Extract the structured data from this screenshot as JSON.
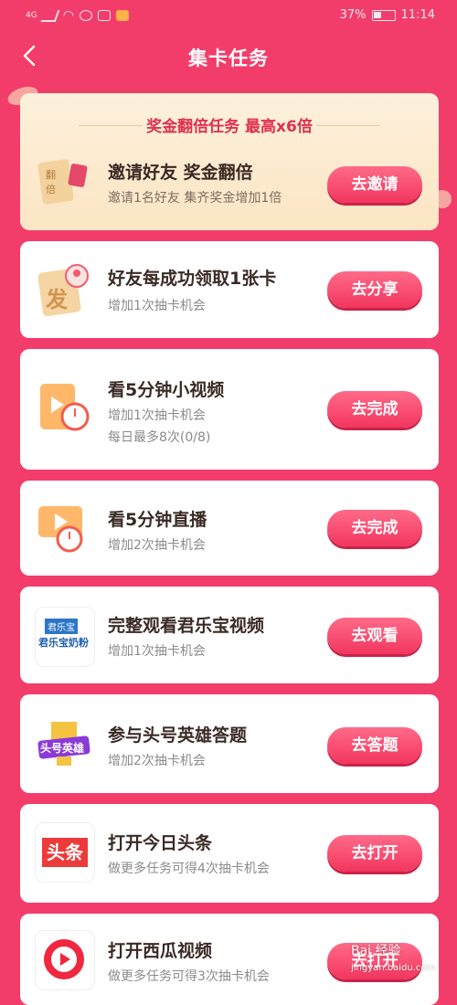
{
  "status": {
    "signal": "4G",
    "battery": "37%",
    "time": "11:14"
  },
  "header": {
    "title": "集卡任务"
  },
  "banner": {
    "headline": "奖金翻倍任务 最高x6倍",
    "task": {
      "title": "邀请好友 奖金翻倍",
      "subtitle": "邀请1名好友 集齐奖金增加1倍",
      "button": "去邀请",
      "icon_text": "翻倍"
    }
  },
  "tasks": [
    {
      "title": "好友每成功领取1张卡",
      "subtitle": "增加1次抽卡机会",
      "button": "去分享",
      "icon": "fa-card-icon",
      "icon_text": "发"
    },
    {
      "title": "看5分钟小视频",
      "subtitle": "增加1次抽卡机会",
      "note": "每日最多8次(0/8)",
      "button": "去完成",
      "icon": "video-timer-icon"
    },
    {
      "title": "看5分钟直播",
      "subtitle": "增加2次抽卡机会",
      "button": "去完成",
      "icon": "live-timer-icon"
    },
    {
      "title": "完整观看君乐宝视频",
      "subtitle": "增加1次抽卡机会",
      "button": "去观看",
      "icon": "junlebao-logo",
      "icon_text": "君乐宝奶粉",
      "icon_text_small": "君乐宝"
    },
    {
      "title": "参与头号英雄答题",
      "subtitle": "增加2次抽卡机会",
      "button": "去答题",
      "icon": "hero-quiz-logo",
      "icon_text": "头号英雄"
    },
    {
      "title": "打开今日头条",
      "subtitle": "做更多任务可得4次抽卡机会",
      "button": "去打开",
      "icon": "toutiao-logo",
      "icon_text": "头条"
    },
    {
      "title": "打开西瓜视频",
      "subtitle": "做更多任务可得3次抽卡机会",
      "button": "去打开",
      "icon": "xigua-logo"
    }
  ],
  "watermark": "Bai 经验",
  "watermark_sub": "jingyan.baidu.com"
}
